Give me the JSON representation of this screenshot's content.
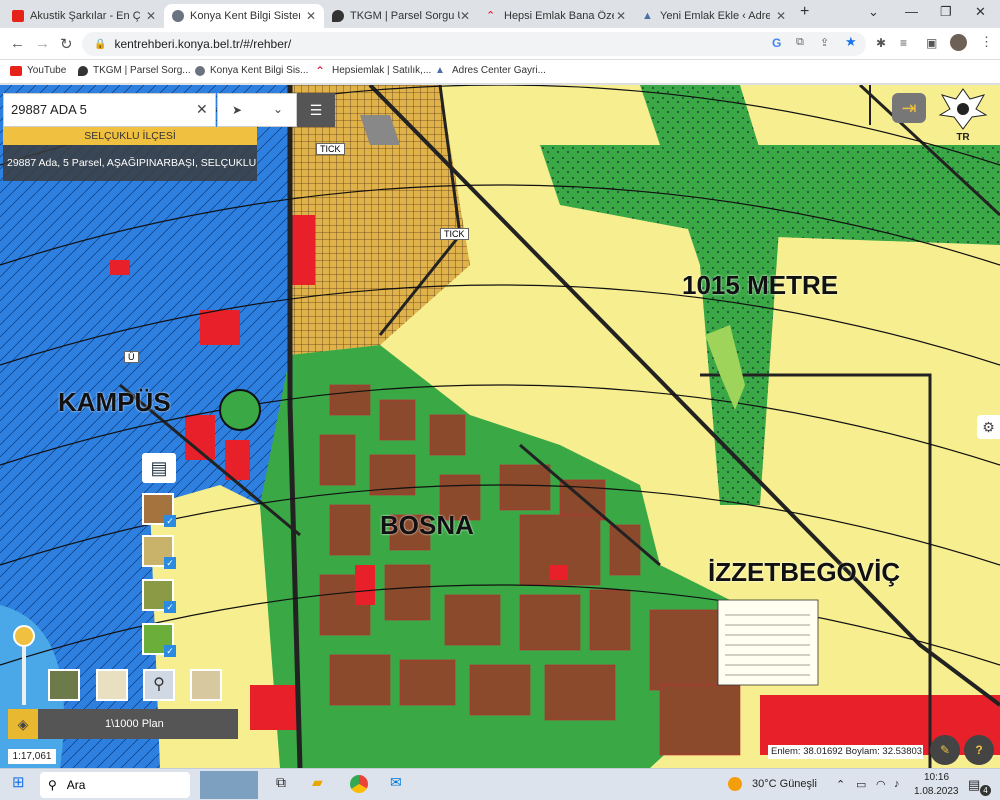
{
  "browser": {
    "tabs": [
      {
        "label": "Akustik Şarkılar - En Ç",
        "icon": "youtube-icon",
        "color": "#e62117",
        "active": false
      },
      {
        "label": "Konya Kent Bilgi Sistemi",
        "icon": "kbs-icon",
        "color": "#6b7280",
        "active": true
      },
      {
        "label": "TKGM | Parsel Sorgu Uyg",
        "icon": "map-pin-icon",
        "color": "#333333",
        "active": false
      },
      {
        "label": "Hepsi Emlak Bana Özel",
        "icon": "hepsiemlak-icon",
        "color": "#e4002b",
        "active": false
      },
      {
        "label": "Yeni Emlak Ekle ‹ Adres C",
        "icon": "adres-center-icon",
        "color": "#4a6fa5",
        "active": false
      }
    ],
    "url": "kentrehberi.konya.bel.tr/#/rehber/",
    "bookmarks": [
      {
        "label": "YouTube",
        "icon": "youtube-icon",
        "color": "#e62117"
      },
      {
        "label": "TKGM | Parsel Sorg...",
        "icon": "map-pin-icon",
        "color": "#333333"
      },
      {
        "label": "Konya Kent Bilgi Sis...",
        "icon": "kbs-icon",
        "color": "#6b7280"
      },
      {
        "label": "Hepsiemlak | Satılık,...",
        "icon": "hepsiemlak-icon",
        "color": "#e4002b"
      },
      {
        "label": "Adres Center Gayri...",
        "icon": "adres-center-icon",
        "color": "#4a6fa5"
      }
    ]
  },
  "map": {
    "search_value": "29887 ADA 5",
    "district_banner": "SELÇUKLU İLÇESİ",
    "parcel_result": "29887 Ada, 5 Parsel, AŞAĞIPINARBAŞI, SELÇUKLU",
    "plan_label": "1\\1000 Plan",
    "scale": "1:17,061",
    "coordinates": "Enlem: 38.01692 Boylam: 32.53803",
    "emblem_label": "TR",
    "labels": {
      "kampus": "KAMPÜS",
      "bosna": "BOSNA",
      "metre": "1015 METRE",
      "izzetbegovic": "İZZETBEGOVİÇ",
      "tick1": "TICK",
      "tick2": "TICK",
      "u": "Ü"
    },
    "colors": {
      "yellow_zone": "#f7ef8f",
      "blue_zone": "#2d7fe0",
      "green_zone": "#3aa845",
      "brown_zone": "#8b5a3c",
      "red_zone": "#e8202a",
      "accent": "#f0c040"
    }
  },
  "taskbar": {
    "search": "Ara",
    "weather": "30°C Güneşli",
    "time": "10:16",
    "date": "1.08.2023",
    "notifications": "4"
  }
}
